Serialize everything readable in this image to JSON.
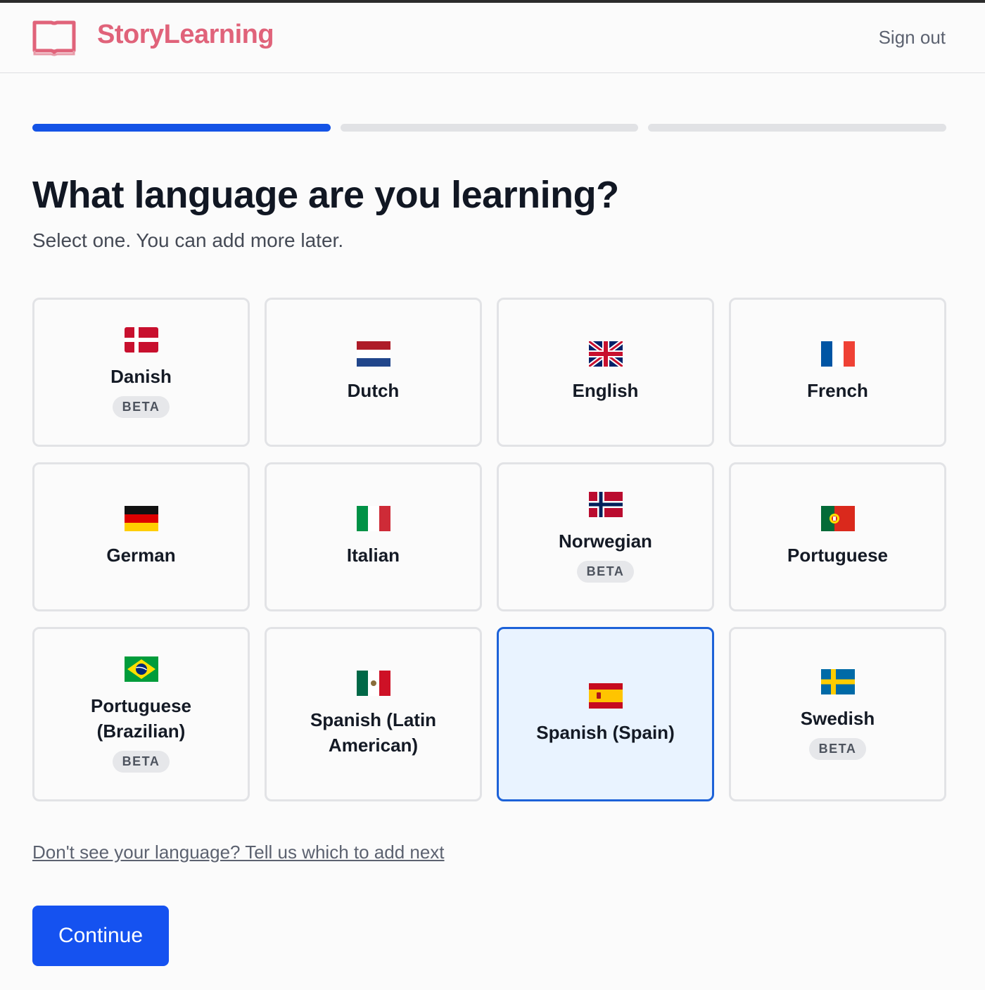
{
  "header": {
    "brand": "StoryLearning",
    "sign_out": "Sign out",
    "brand_color": "#e0637a"
  },
  "progress": {
    "step": 1,
    "total_steps": 3,
    "active_color": "#1453e6"
  },
  "main": {
    "title": "What language are you learning?",
    "subtitle": "Select one. You can add more later.",
    "languages": [
      {
        "name": "Danish",
        "badge": "BETA",
        "flag": "flag-denmark-icon",
        "selected": false
      },
      {
        "name": "Dutch",
        "badge": "",
        "flag": "flag-netherlands-icon",
        "selected": false
      },
      {
        "name": "English",
        "badge": "",
        "flag": "flag-uk-icon",
        "selected": false
      },
      {
        "name": "French",
        "badge": "",
        "flag": "flag-france-icon",
        "selected": false
      },
      {
        "name": "German",
        "badge": "",
        "flag": "flag-germany-icon",
        "selected": false
      },
      {
        "name": "Italian",
        "badge": "",
        "flag": "flag-italy-icon",
        "selected": false
      },
      {
        "name": "Norwegian",
        "badge": "BETA",
        "flag": "flag-norway-icon",
        "selected": false
      },
      {
        "name": "Portuguese",
        "badge": "",
        "flag": "flag-portugal-icon",
        "selected": false
      },
      {
        "name": "Portuguese (Brazilian)",
        "badge": "BETA",
        "flag": "flag-brazil-icon",
        "selected": false
      },
      {
        "name": "Spanish (Latin American)",
        "badge": "",
        "flag": "flag-mexico-icon",
        "selected": false
      },
      {
        "name": "Spanish (Spain)",
        "badge": "",
        "flag": "flag-spain-icon",
        "selected": true
      },
      {
        "name": "Swedish",
        "badge": "BETA",
        "flag": "flag-sweden-icon",
        "selected": false
      }
    ],
    "request_link": "Don't see your language? Tell us which to add next",
    "continue_label": "Continue",
    "selected_color": "#1d62d8",
    "button_color": "#1552f0"
  }
}
